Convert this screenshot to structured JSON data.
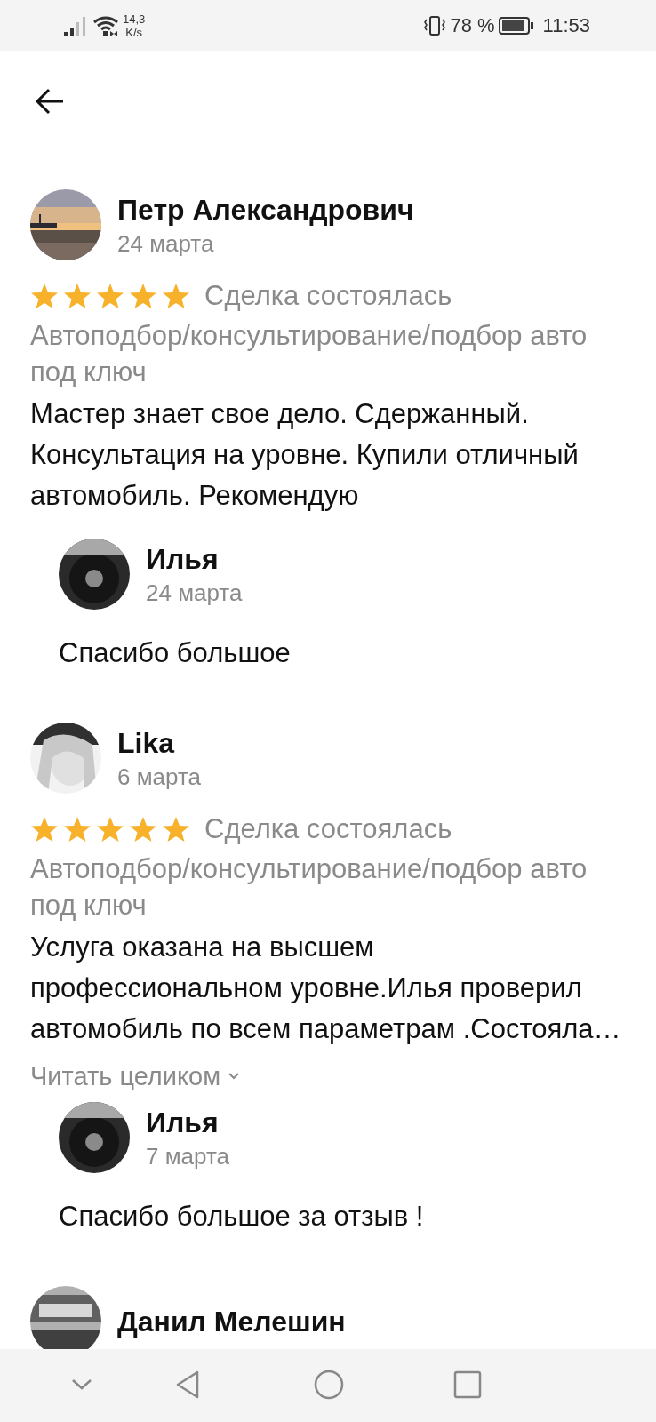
{
  "status_bar": {
    "speed_value": "14,3",
    "speed_unit": "K/s",
    "battery": "78 %",
    "time": "11:53"
  },
  "reviews": [
    {
      "author": "Петр Александрович",
      "date": "24 марта",
      "stars": 5,
      "status": "Сделка состоялась",
      "category": "Автоподбор/консультирование/подбор авто под ключ",
      "text": "Мастер знает свое дело. Сдержанный. Консультация на уровне. Купили отличный автомобиль. Рекомендую",
      "reply": {
        "author": "Илья",
        "date": "24 марта",
        "text": "Спасибо большое"
      }
    },
    {
      "author": "Lika",
      "date": "6 марта",
      "stars": 5,
      "status": "Сделка состоялась",
      "category": "Автоподбор/консультирование/подбор авто под ключ",
      "text": "Услуга оказана на высшем профессиональном уровне.Илья проверил автомобиль по всем параметрам .Состояла…",
      "read_more": "Читать целиком",
      "reply": {
        "author": "Илья",
        "date": "7 марта",
        "text": "Спасибо большое за отзыв !"
      }
    },
    {
      "author": "Данил Мелешин"
    }
  ]
}
